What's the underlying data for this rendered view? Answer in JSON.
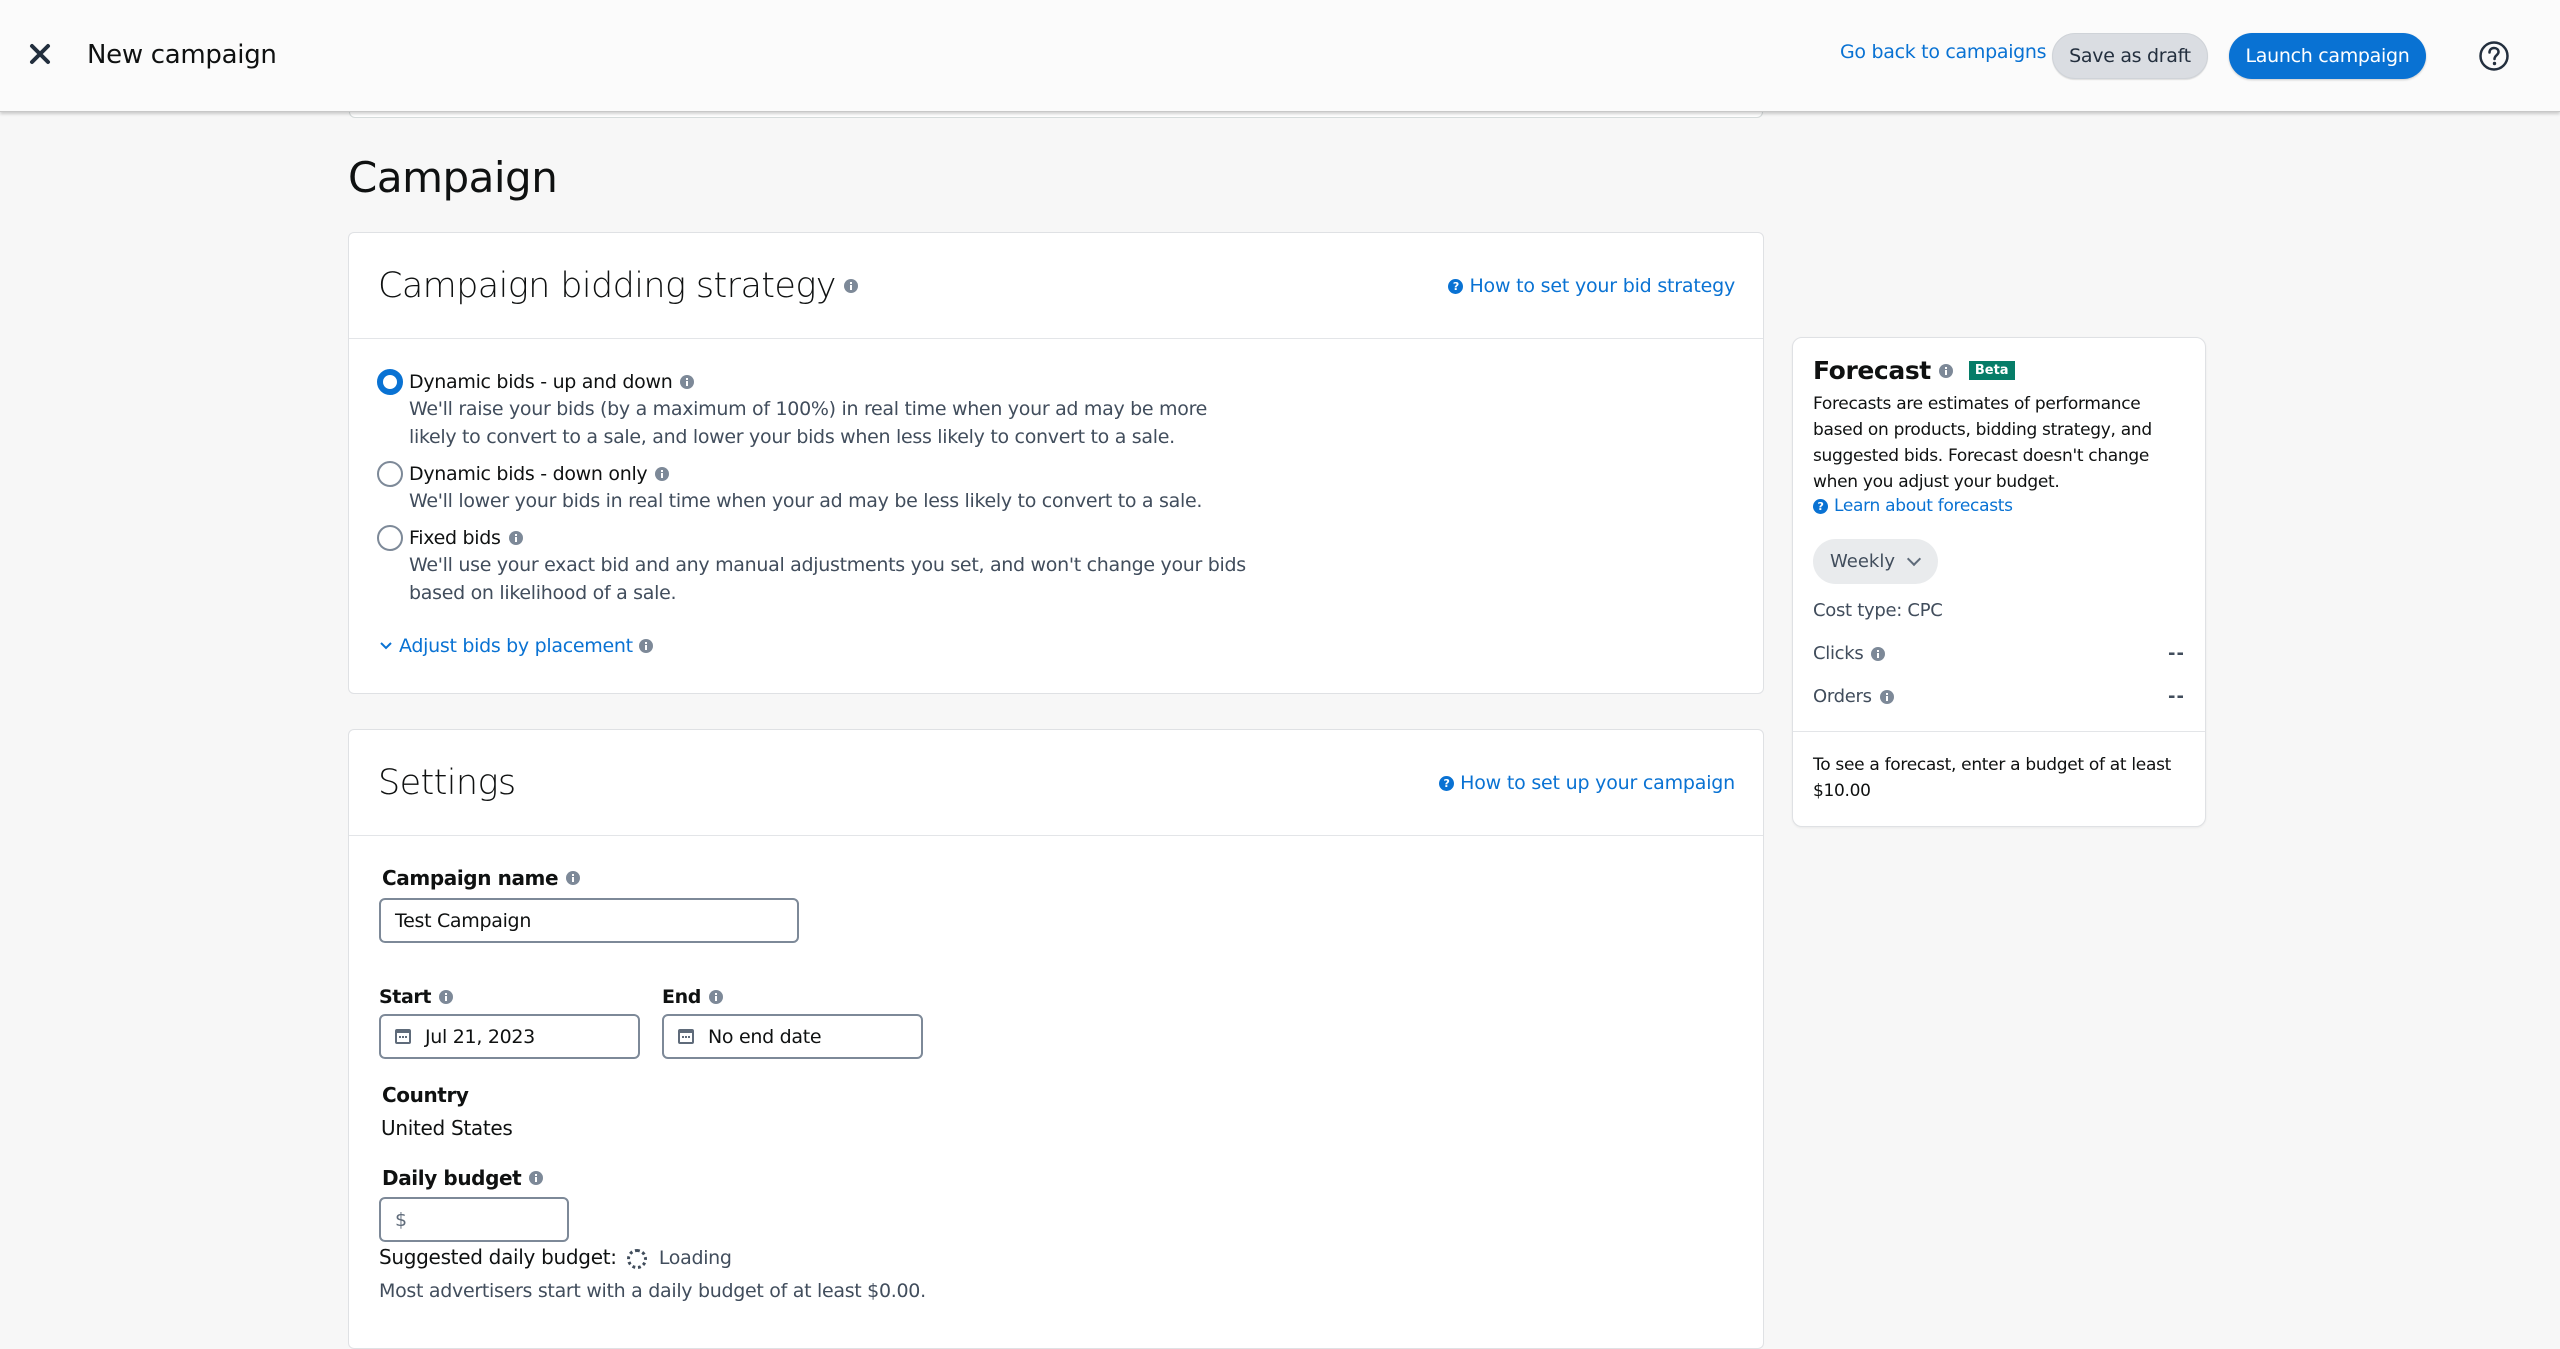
{
  "header": {
    "title": "New campaign",
    "close_icon": "close-icon",
    "back_link": "Go back to campaigns",
    "save_draft": "Save as draft",
    "launch": "Launch campaign",
    "help_icon": "help-circle-icon"
  },
  "page": {
    "section_title": "Campaign"
  },
  "bidding": {
    "title": "Campaign bidding strategy",
    "help_link": "How to set your bid strategy",
    "options": [
      {
        "label": "Dynamic bids - up and down",
        "description": "We'll raise your bids (by a maximum of 100%) in real time when your ad may be more likely to convert to a sale, and lower your bids when less likely to convert to a sale.",
        "selected": true
      },
      {
        "label": "Dynamic bids - down only",
        "description": "We'll lower your bids in real time when your ad may be less likely to convert to a sale.",
        "selected": false
      },
      {
        "label": "Fixed bids",
        "description": "We'll use your exact bid and any manual adjustments you set, and won't change your bids based on likelihood of a sale.",
        "selected": false
      }
    ],
    "adjust_link": "Adjust bids by placement"
  },
  "settings": {
    "title": "Settings",
    "help_link": "How to set up your campaign",
    "campaign_name_label": "Campaign name",
    "campaign_name_value": "Test Campaign",
    "start_label": "Start",
    "start_value": "Jul 21, 2023",
    "end_label": "End",
    "end_value": "No end date",
    "country_label": "Country",
    "country_value": "United States",
    "daily_budget_label": "Daily budget",
    "daily_budget_prefix": "$",
    "daily_budget_value": "",
    "suggested_label": "Suggested daily budget:",
    "suggested_status": "Loading",
    "advice": "Most advertisers start with a daily budget of at least $0.00."
  },
  "forecast": {
    "title": "Forecast",
    "badge": "Beta",
    "description": "Forecasts are estimates of performance based on products, bidding strategy, and suggested bids. Forecast doesn't change when you adjust your budget.",
    "learn_link": "Learn about forecasts",
    "period": "Weekly",
    "cost_type": "Cost type: CPC",
    "metrics": [
      {
        "label": "Clicks",
        "value": "--"
      },
      {
        "label": "Orders",
        "value": "--"
      }
    ],
    "note": "To see a forecast, enter a budget of at least $10.00"
  },
  "colors": {
    "accent": "#0972d3",
    "badge": "#067d68",
    "background": "#f7f7f7"
  }
}
